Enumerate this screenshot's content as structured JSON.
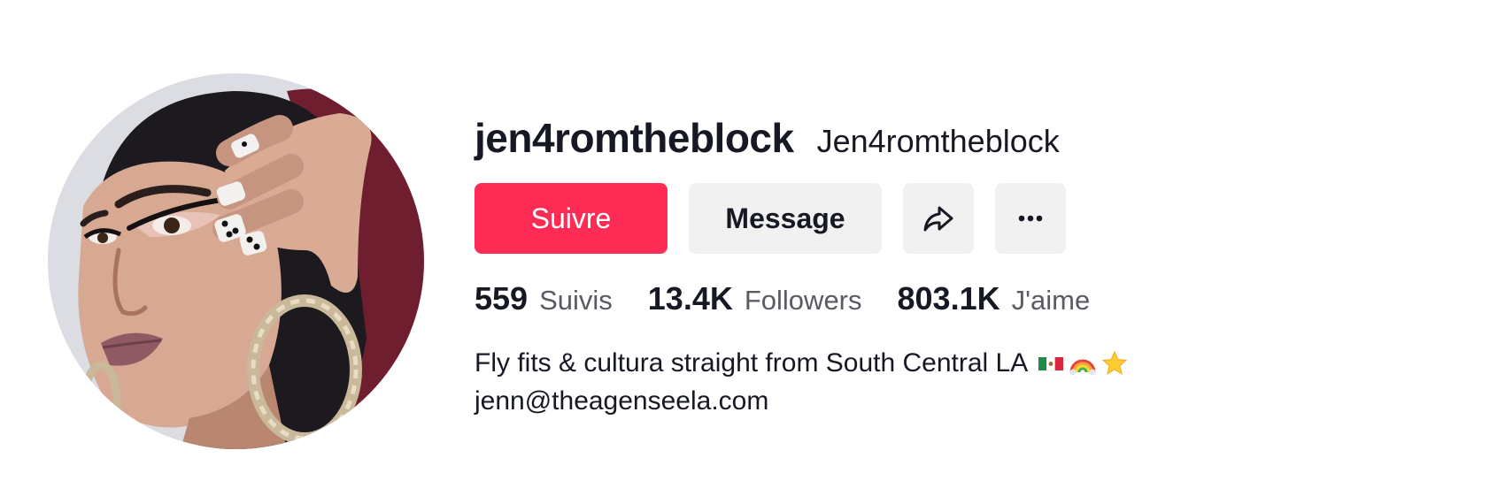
{
  "profile": {
    "username": "jen4romtheblock",
    "nickname": "Jen4romtheblock",
    "avatar_icon": "profile-photo"
  },
  "actions": {
    "follow_label": "Suivre",
    "message_label": "Message",
    "share_icon": "share-arrow-icon",
    "more_icon": "more-dots-icon"
  },
  "stats": [
    {
      "value": "559",
      "label": "Suivis"
    },
    {
      "value": "13.4K",
      "label": "Followers"
    },
    {
      "value": "803.1K",
      "label": "J'aime"
    }
  ],
  "bio": {
    "line1": "Fly fits & cultura straight from South Central LA",
    "emojis": [
      "mexico-flag-emoji",
      "rainbow-emoji",
      "star-emoji"
    ],
    "line2": "jenn@theagenseela.com"
  },
  "colors": {
    "accent": "#fe2c55",
    "button_bg": "#f1f1f2",
    "text": "#161823",
    "muted": "#5a5a62"
  }
}
